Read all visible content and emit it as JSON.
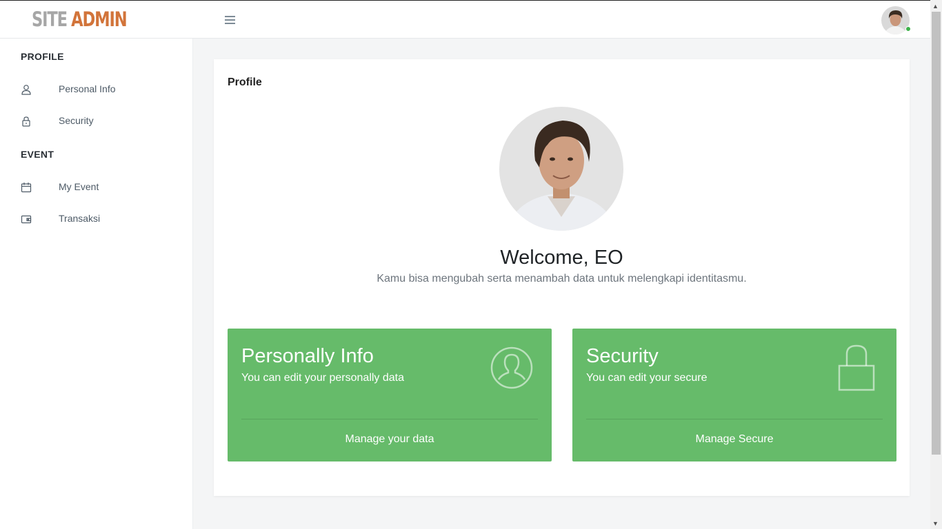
{
  "header": {
    "logo_part1": "SITE",
    "logo_part2": "ADMIN",
    "menu_icon": "hamburger-menu-icon",
    "avatar_icon": "user-avatar",
    "online_color": "#3cb14a"
  },
  "sidebar": {
    "sections": [
      {
        "title": "PROFILE",
        "items": [
          {
            "label": "Personal Info",
            "icon": "user-icon"
          },
          {
            "label": "Security",
            "icon": "lock-icon"
          }
        ]
      },
      {
        "title": "EVENT",
        "items": [
          {
            "label": "My Event",
            "icon": "calendar-icon"
          },
          {
            "label": "Transaksi",
            "icon": "wallet-icon"
          }
        ]
      }
    ]
  },
  "main": {
    "card_title": "Profile",
    "welcome": "Welcome, EO",
    "subtitle": "Kamu bisa mengubah serta menambah data untuk melengkapi identitasmu.",
    "tiles": [
      {
        "title": "Personally Info",
        "subtitle": "You can edit your personally data",
        "link": "Manage your data",
        "icon": "user-circle-icon"
      },
      {
        "title": "Security",
        "subtitle": "You can edit your secure",
        "link": "Manage Secure",
        "icon": "lock-icon"
      }
    ]
  },
  "colors": {
    "accent_orange": "#d2743a",
    "tile_green": "#66bb6a"
  }
}
